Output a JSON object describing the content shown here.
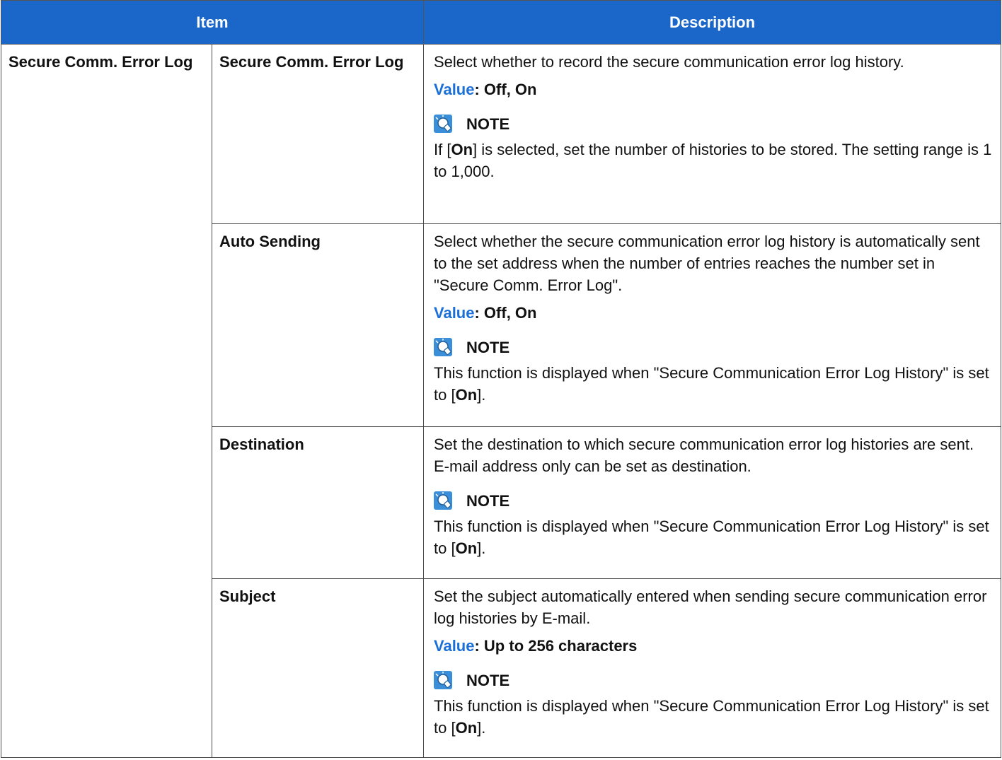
{
  "header": {
    "item": "Item",
    "description": "Description"
  },
  "group": "Secure Comm. Error Log",
  "rows": [
    {
      "name": "Secure Comm. Error Log",
      "desc": "Select whether to record the secure communication error log history.",
      "value_label": "Value",
      "value": ": Off, On",
      "note_label": "NOTE",
      "note": {
        "pre": "If [",
        "bold": "On",
        "post": "] is selected, set the number of histories to be stored. The setting range is 1 to 1,000."
      }
    },
    {
      "name": "Auto Sending",
      "desc": "Select whether the secure communication error log history is automatically sent to the set address when the number of entries reaches the number set in \"Secure Comm. Error Log\".",
      "value_label": "Value",
      "value": ": Off, On",
      "note_label": "NOTE",
      "note": {
        "pre": "This function is displayed when \"Secure Communication Error Log History\" is set to [",
        "bold": "On",
        "post": "]."
      }
    },
    {
      "name": "Destination",
      "desc": "Set the destination to which secure communication error log histories are sent. E-mail address only can be set as destination.",
      "note_label": "NOTE",
      "note": {
        "pre": "This function is displayed when \"Secure Communication Error Log History\" is set to [",
        "bold": "On",
        "post": "]."
      }
    },
    {
      "name": "Subject",
      "desc": "Set the subject automatically entered when sending secure communication error log histories by E-mail.",
      "value_label": "Value",
      "value": ": Up to 256 characters",
      "note_label": "NOTE",
      "note": {
        "pre": "This function is displayed when \"Secure Communication Error Log History\" is set to [",
        "bold": "On",
        "post": "]."
      }
    }
  ],
  "icons": {
    "note": "note-lightbulb-icon"
  },
  "colors": {
    "header_bg": "#1a66c9",
    "value_label": "#1a6fd8"
  }
}
